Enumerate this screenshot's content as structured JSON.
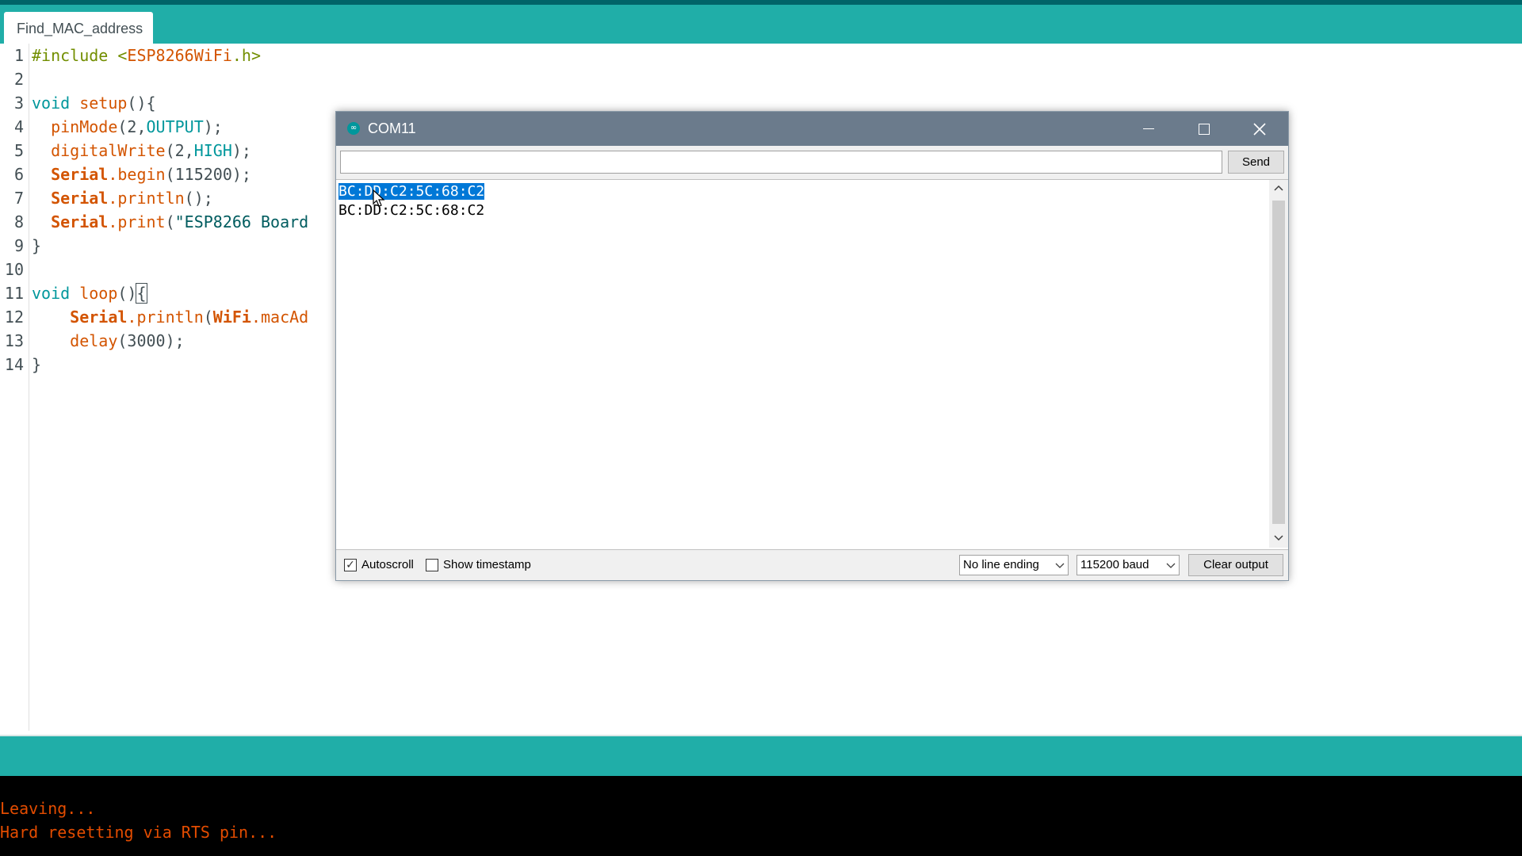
{
  "tab": {
    "label": "Find_MAC_address"
  },
  "editor": {
    "line_numbers": [
      "1",
      "2",
      "3",
      "4",
      "5",
      "6",
      "7",
      "8",
      "9",
      "10",
      "11",
      "12",
      "13",
      "14"
    ],
    "lines": {
      "l1_pp": "#include <",
      "l1_lib": "ESP8266WiFi",
      "l1_end": ".h>",
      "l3_kw": "void",
      "l3_fn": " setup",
      "l3_rest": "(){",
      "l4_fn": "  pinMode",
      "l4_a": "(2,",
      "l4_const": "OUTPUT",
      "l4_b": ");",
      "l5_fn": "  digitalWrite",
      "l5_a": "(2,",
      "l5_const": "HIGH",
      "l5_b": ");",
      "l6_cls": "  Serial",
      "l6_fn": ".begin",
      "l6_rest": "(115200);",
      "l7_cls": "  Serial",
      "l7_fn": ".println",
      "l7_rest": "();",
      "l8_cls": "  Serial",
      "l8_fn": ".print",
      "l8_a": "(",
      "l8_str": "\"ESP8266 Board",
      "l9": "}",
      "l11_kw": "void",
      "l11_fn": " loop",
      "l11_rest": "()",
      "l11_brace": "{",
      "l12_cls": "    Serial",
      "l12_fn": ".println",
      "l12_a": "(",
      "l12_cls2": "WiFi",
      "l12_fn2": ".macAd",
      "l13_fn": "    delay",
      "l13_rest": "(3000);",
      "l14": "}"
    }
  },
  "console": {
    "lines": [
      "Leaving...",
      "Hard resetting via RTS pin..."
    ]
  },
  "monitor": {
    "title": "COM11",
    "logo_glyph": "∞",
    "send_input_value": "",
    "send_label": "Send",
    "output_lines": [
      "BC:DD:C2:5C:68:C2",
      "BC:DD:C2:5C:68:C2"
    ],
    "autoscroll_label": "Autoscroll",
    "autoscroll_checked": true,
    "show_timestamp_label": "Show timestamp",
    "show_timestamp_checked": false,
    "line_ending_value": "No line ending",
    "baud_value": "115200 baud",
    "clear_label": "Clear output",
    "check_glyph": "✓",
    "icons": [
      "minimize-icon",
      "maximize-icon",
      "close-icon",
      "chevron-down-icon",
      "chevron-up-icon"
    ]
  },
  "colors": {
    "teal": "#20aea8",
    "dark_teal": "#006468",
    "selection": "#0078d7",
    "console_text": "#e34c00",
    "title_bar": "#6b7b8c"
  }
}
